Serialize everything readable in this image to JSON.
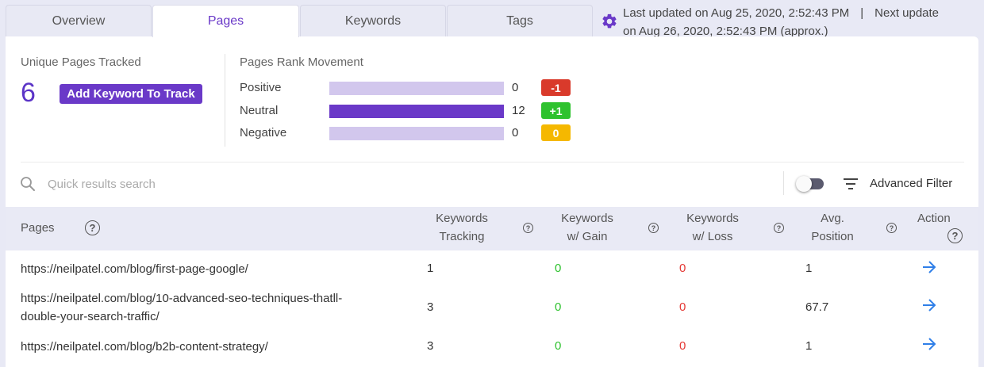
{
  "tabs": [
    {
      "label": "Overview",
      "active": false
    },
    {
      "label": "Pages",
      "active": true
    },
    {
      "label": "Keywords",
      "active": false
    },
    {
      "label": "Tags",
      "active": false
    }
  ],
  "update_info": {
    "last_updated": "Last updated on Aug 25, 2020, 2:52:43 PM",
    "separator": "|",
    "next_update_label": "Next update",
    "next_update": "on Aug 26, 2020, 2:52:43 PM (approx.)"
  },
  "summary": {
    "unique_label": "Unique Pages Tracked",
    "unique_count": "6",
    "add_button": "Add Keyword To Track"
  },
  "rank_movement": {
    "title": "Pages Rank Movement",
    "rows": [
      {
        "label": "Positive",
        "value": "0",
        "fill": 0,
        "badge": "-1",
        "badge_color": "#d93a2b"
      },
      {
        "label": "Neutral",
        "value": "12",
        "fill": 1,
        "badge": "+1",
        "badge_color": "#2ec22e"
      },
      {
        "label": "Negative",
        "value": "0",
        "fill": 0,
        "badge": "0",
        "badge_color": "#f5b800"
      }
    ]
  },
  "search": {
    "placeholder": "Quick results search"
  },
  "filter": {
    "label": "Advanced Filter",
    "toggle_on": false
  },
  "table": {
    "headers": {
      "pages": "Pages",
      "kw_tracking_1": "Keywords",
      "kw_tracking_2": "Tracking",
      "kw_gain_1": "Keywords",
      "kw_gain_2": "w/ Gain",
      "kw_loss_1": "Keywords",
      "kw_loss_2": "w/ Loss",
      "avg_pos_1": "Avg.",
      "avg_pos_2": "Position",
      "action": "Action"
    },
    "rows": [
      {
        "url_line1": "https://neilpatel.com/blog/first-page-google/",
        "url_line2": "",
        "tracking": "1",
        "gain": "0",
        "loss": "0",
        "avg": "1"
      },
      {
        "url_line1": "https://neilpatel.com/blog/10-advanced-seo-techniques-thatll-",
        "url_line2": "double-your-search-traffic/",
        "tracking": "3",
        "gain": "0",
        "loss": "0",
        "avg": "67.7"
      },
      {
        "url_line1": "https://neilpatel.com/blog/b2b-content-strategy/",
        "url_line2": "",
        "tracking": "3",
        "gain": "0",
        "loss": "0",
        "avg": "1"
      }
    ]
  },
  "colors": {
    "accent": "#6a39c8",
    "gain": "#2ec22e",
    "loss": "#e53935"
  }
}
